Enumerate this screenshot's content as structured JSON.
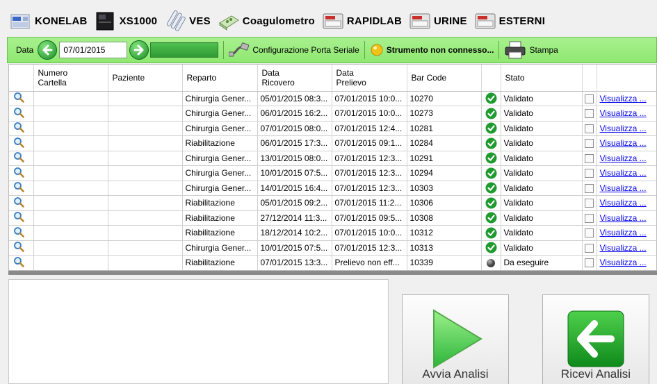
{
  "tabs": [
    {
      "label": "KONELAB",
      "icon": "analyzer-blue-icon"
    },
    {
      "label": "XS1000",
      "icon": "analyzer-black-icon"
    },
    {
      "label": "VES",
      "icon": "test-tube-icon"
    },
    {
      "label": "Coagulometro",
      "icon": "coagulometer-icon"
    },
    {
      "label": "RAPIDLAB",
      "icon": "lab-instrument-icon"
    },
    {
      "label": "URINE",
      "icon": "lab-instrument-icon"
    },
    {
      "label": "ESTERNI",
      "icon": "lab-instrument-icon"
    }
  ],
  "toolbar": {
    "date_label": "Data",
    "date_value": "07/01/2015",
    "progress": 1.0,
    "config_label": "Configurazione Porta Seriale",
    "status_label": "Strumento non connesso...",
    "print_label": "Stampa"
  },
  "table": {
    "headers": [
      "",
      "Numero\nCartella",
      "Paziente",
      "Reparto",
      "Data\nRicovero",
      "Data\nPrelievo",
      "Bar Code",
      "",
      "Stato",
      "",
      ""
    ],
    "header_lines": {
      "numero": [
        "Numero",
        "Cartella"
      ],
      "paziente": "Paziente",
      "reparto": "Reparto",
      "ricovero": [
        "Data",
        "Ricovero"
      ],
      "prelievo": [
        "Data",
        "Prelievo"
      ],
      "barcode": "Bar Code",
      "stato": "Stato"
    },
    "rows": [
      {
        "reparto": "Chirurgia Gener...",
        "ricovero": "05/01/2015 08:3...",
        "prelievo": "07/01/2015 10:0...",
        "barcode": "10270",
        "stato": "Validato",
        "ok": true,
        "link": "Visualizza ..."
      },
      {
        "reparto": "Chirurgia Gener...",
        "ricovero": "06/01/2015 16:2...",
        "prelievo": "07/01/2015 10:0...",
        "barcode": "10273",
        "stato": "Validato",
        "ok": true,
        "link": "Visualizza ..."
      },
      {
        "reparto": "Chirurgia Gener...",
        "ricovero": "07/01/2015 08:0...",
        "prelievo": "07/01/2015 12:4...",
        "barcode": "10281",
        "stato": "Validato",
        "ok": true,
        "link": "Visualizza ..."
      },
      {
        "reparto": "Riabilitazione",
        "ricovero": "06/01/2015 17:3...",
        "prelievo": "07/01/2015 09:1...",
        "barcode": "10284",
        "stato": "Validato",
        "ok": true,
        "link": "Visualizza ..."
      },
      {
        "reparto": "Chirurgia Gener...",
        "ricovero": "13/01/2015 08:0...",
        "prelievo": "07/01/2015 12:3...",
        "barcode": "10291",
        "stato": "Validato",
        "ok": true,
        "link": "Visualizza ..."
      },
      {
        "reparto": "Chirurgia Gener...",
        "ricovero": "10/01/2015 07:5...",
        "prelievo": "07/01/2015 12:3...",
        "barcode": "10294",
        "stato": "Validato",
        "ok": true,
        "link": "Visualizza ..."
      },
      {
        "reparto": "Chirurgia Gener...",
        "ricovero": "14/01/2015 16:4...",
        "prelievo": "07/01/2015 12:3...",
        "barcode": "10303",
        "stato": "Validato",
        "ok": true,
        "link": "Visualizza ..."
      },
      {
        "reparto": "Riabilitazione",
        "ricovero": "05/01/2015 09:2...",
        "prelievo": "07/01/2015 11:2...",
        "barcode": "10306",
        "stato": "Validato",
        "ok": true,
        "link": "Visualizza ..."
      },
      {
        "reparto": "Riabilitazione",
        "ricovero": "27/12/2014 11:3...",
        "prelievo": "07/01/2015 09:5...",
        "barcode": "10308",
        "stato": "Validato",
        "ok": true,
        "link": "Visualizza ..."
      },
      {
        "reparto": "Riabilitazione",
        "ricovero": "18/12/2014 10:2...",
        "prelievo": "07/01/2015 10:0...",
        "barcode": "10312",
        "stato": "Validato",
        "ok": true,
        "link": "Visualizza ..."
      },
      {
        "reparto": "Chirurgia Gener...",
        "ricovero": "10/01/2015 07:5...",
        "prelievo": "07/01/2015 12:3...",
        "barcode": "10313",
        "stato": "Validato",
        "ok": true,
        "link": "Visualizza ..."
      },
      {
        "reparto": "Riabilitazione",
        "ricovero": "07/01/2015 13:3...",
        "prelievo": "Prelievo non eff...",
        "barcode": "10339",
        "stato": "Da eseguire",
        "ok": false,
        "link": "Visualizza ..."
      }
    ]
  },
  "actions": {
    "start_label": "Avvia Analisi",
    "receive_label": "Ricevi Analisi"
  },
  "colors": {
    "toolbar_green": "#97ec78",
    "ok_green": "#1f9a2e",
    "link_blue": "#0000ee"
  }
}
